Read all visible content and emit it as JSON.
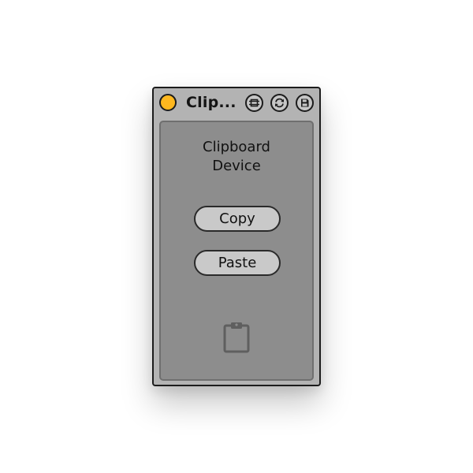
{
  "device": {
    "title": "Clip...",
    "label_line1": "Clipboard",
    "label_line2": "Device"
  },
  "buttons": {
    "copy_label": "Copy",
    "paste_label": "Paste"
  },
  "header_icons": [
    "hot-swap-icon",
    "refresh-icon",
    "save-icon"
  ],
  "content_icon": "clipboard-icon",
  "colors": {
    "activator": "#ffb81f",
    "device_body": "#b3b3b3",
    "panel": "#8d8d8d",
    "button": "#c9c9c9"
  }
}
